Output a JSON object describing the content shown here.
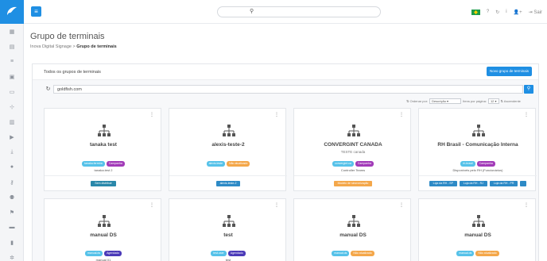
{
  "sidebar": {
    "icons": [
      "grid-icon",
      "table-icon",
      "list-icon",
      "media-icon",
      "monitor-icon",
      "network-icon",
      "calendar-icon",
      "play-icon",
      "download-icon",
      "user-icon",
      "key-icon",
      "users-icon",
      "flag-icon",
      "message-icon",
      "trash-icon",
      "gear-icon"
    ]
  },
  "topbar": {
    "menu_glyph": "≡",
    "search_glyph": "⚲",
    "right": {
      "help": "?",
      "refresh": "↻",
      "info": "i",
      "user_add": "👤+",
      "logout_label": "Sair"
    }
  },
  "header": {
    "title": "Grupo de terminais",
    "crumb_root": "Inova Digital Signage",
    "crumb_sep": ">",
    "crumb_current": "Grupo de terminais"
  },
  "panel": {
    "title": "Todos os grupos de terminais",
    "new_button": "Novo grupo de terminais"
  },
  "filter": {
    "refresh_glyph": "↻",
    "value": "goldfish.com",
    "search_glyph": "⚲"
  },
  "sort": {
    "order_label": "⇅ Ordenar por:",
    "order_value": "Descrição",
    "per_page_label": "Itens por página:",
    "per_page_value": "12",
    "direction_label": "Ascendente"
  },
  "cards": [
    {
      "name": "tanaka test",
      "sub": "",
      "badges": [
        {
          "label": "tanaka.ferreira",
          "color": "blue"
        },
        {
          "label": "Campanha",
          "color": "purple"
        }
      ],
      "owner": "tanaka.test 2",
      "buttons": [
        {
          "label": "Sem distribuir",
          "color": "teal"
        }
      ]
    },
    {
      "name": "alexis-teste-2",
      "sub": "",
      "badges": [
        {
          "label": "alexis.teste",
          "color": "blue"
        },
        {
          "label": "Não atualizado",
          "color": "orange"
        }
      ],
      "owner": "",
      "buttons": [
        {
          "label": "alexis-teste-2",
          "color": "blue"
        }
      ]
    },
    {
      "name": "CONVERGINT CANADA",
      "sub": "TESTE canada",
      "badges": [
        {
          "label": "convergint.ca",
          "color": "blue"
        },
        {
          "label": "Campanha",
          "color": "purple"
        }
      ],
      "owner": "Controller Teams",
      "buttons": [
        {
          "label": "Modelo de sincronização",
          "color": "orange"
        }
      ]
    },
    {
      "name": "RH Brasil - Comunicação Interna",
      "sub": "",
      "badges": [
        {
          "label": "rh.brasil",
          "color": "blue"
        },
        {
          "label": "Campanha",
          "color": "purple"
        }
      ],
      "owner": "Disponíveis pelo RH (Funcionários)",
      "buttons": [
        {
          "label": "Loja da RH - SP",
          "color": "blue"
        },
        {
          "label": "Loja da RH - RJ",
          "color": "blue"
        },
        {
          "label": "Loja da RH - PR",
          "color": "blue"
        },
        {
          "label": "",
          "color": "sq"
        }
      ]
    },
    {
      "name": "manual DS",
      "sub": "",
      "badges": [
        {
          "label": "manual.ds",
          "color": "blue"
        },
        {
          "label": "Agendado",
          "color": "indigo"
        }
      ],
      "owner": "manual 01",
      "buttons": []
    },
    {
      "name": "test",
      "sub": "",
      "badges": [
        {
          "label": "test.user",
          "color": "blue"
        },
        {
          "label": "Agendado",
          "color": "indigo"
        }
      ],
      "owner": "test",
      "buttons": []
    },
    {
      "name": "manual DS",
      "sub": "",
      "badges": [
        {
          "label": "manual.ds",
          "color": "blue"
        },
        {
          "label": "Não atualizado",
          "color": "orange"
        }
      ],
      "owner": "",
      "buttons": []
    },
    {
      "name": "manual DS",
      "sub": "",
      "badges": [
        {
          "label": "manual.ds",
          "color": "blue"
        },
        {
          "label": "Não atualizado",
          "color": "orange"
        }
      ],
      "owner": "",
      "buttons": []
    }
  ],
  "colors": {
    "accent": "#1f8fe3",
    "badge_blue": "#56c2e9",
    "badge_purple": "#a23bb8",
    "badge_orange": "#f4a74a"
  }
}
